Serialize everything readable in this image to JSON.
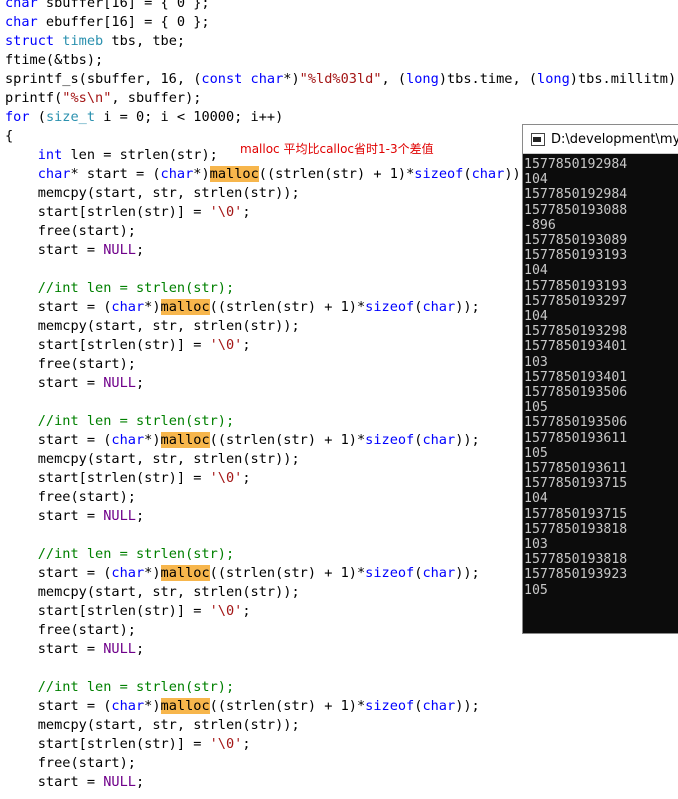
{
  "editor": {
    "code_lines": [
      [
        {
          "t": "char",
          "c": "kw"
        },
        {
          "t": " sbuffer[16] = { 0 };"
        }
      ],
      [
        {
          "t": "char",
          "c": "kw"
        },
        {
          "t": " ebuffer[16] = { 0 };"
        }
      ],
      [
        {
          "t": "struct",
          "c": "kw"
        },
        {
          "t": " "
        },
        {
          "t": "timeb",
          "c": "ty"
        },
        {
          "t": " tbs, tbe;"
        }
      ],
      [
        {
          "t": "ftime(&tbs);"
        }
      ],
      [
        {
          "t": "sprintf_s(sbuffer, 16, ("
        },
        {
          "t": "const",
          "c": "kw"
        },
        {
          "t": " "
        },
        {
          "t": "char",
          "c": "kw"
        },
        {
          "t": "*)"
        },
        {
          "t": "\"%ld%03ld\"",
          "c": "str"
        },
        {
          "t": ", ("
        },
        {
          "t": "long",
          "c": "kw"
        },
        {
          "t": ")tbs.time, ("
        },
        {
          "t": "long",
          "c": "kw"
        },
        {
          "t": ")tbs.millitm);"
        }
      ],
      [
        {
          "t": "printf("
        },
        {
          "t": "\"%s\\n\"",
          "c": "str"
        },
        {
          "t": ", sbuffer);"
        }
      ],
      [
        {
          "t": "for",
          "c": "kw"
        },
        {
          "t": " ("
        },
        {
          "t": "size_t",
          "c": "ty"
        },
        {
          "t": " i = 0; i < 10000; i++)"
        }
      ],
      [
        {
          "t": "{"
        }
      ],
      [
        {
          "t": "    "
        },
        {
          "t": "int",
          "c": "kw"
        },
        {
          "t": " len = strlen(str);"
        }
      ],
      [
        {
          "t": "    "
        },
        {
          "t": "char",
          "c": "kw"
        },
        {
          "t": "* start = ("
        },
        {
          "t": "char",
          "c": "kw"
        },
        {
          "t": "*)"
        },
        {
          "t": "malloc",
          "c": "hl"
        },
        {
          "t": "((strlen(str) + 1)*"
        },
        {
          "t": "sizeof",
          "c": "kw"
        },
        {
          "t": "("
        },
        {
          "t": "char",
          "c": "kw"
        },
        {
          "t": "));"
        }
      ],
      [
        {
          "t": "    memcpy(start, str, strlen(str));"
        }
      ],
      [
        {
          "t": "    start[strlen(str)] = "
        },
        {
          "t": "'\\0'",
          "c": "str"
        },
        {
          "t": ";"
        }
      ],
      [
        {
          "t": "    free(start);"
        }
      ],
      [
        {
          "t": "    start = "
        },
        {
          "t": "NULL",
          "c": "mac"
        },
        {
          "t": ";"
        }
      ],
      [],
      [
        {
          "t": "    "
        },
        {
          "t": "//int len = strlen(str);",
          "c": "cm"
        }
      ],
      [
        {
          "t": "    start = ("
        },
        {
          "t": "char",
          "c": "kw"
        },
        {
          "t": "*)"
        },
        {
          "t": "malloc",
          "c": "hl"
        },
        {
          "t": "((strlen(str) + 1)*"
        },
        {
          "t": "sizeof",
          "c": "kw"
        },
        {
          "t": "("
        },
        {
          "t": "char",
          "c": "kw"
        },
        {
          "t": "));"
        }
      ],
      [
        {
          "t": "    memcpy(start, str, strlen(str));"
        }
      ],
      [
        {
          "t": "    start[strlen(str)] = "
        },
        {
          "t": "'\\0'",
          "c": "str"
        },
        {
          "t": ";"
        }
      ],
      [
        {
          "t": "    free(start);"
        }
      ],
      [
        {
          "t": "    start = "
        },
        {
          "t": "NULL",
          "c": "mac"
        },
        {
          "t": ";"
        }
      ],
      [],
      [
        {
          "t": "    "
        },
        {
          "t": "//int len = strlen(str);",
          "c": "cm"
        }
      ],
      [
        {
          "t": "    start = ("
        },
        {
          "t": "char",
          "c": "kw"
        },
        {
          "t": "*)"
        },
        {
          "t": "malloc",
          "c": "hl"
        },
        {
          "t": "((strlen(str) + 1)*"
        },
        {
          "t": "sizeof",
          "c": "kw"
        },
        {
          "t": "("
        },
        {
          "t": "char",
          "c": "kw"
        },
        {
          "t": "));"
        }
      ],
      [
        {
          "t": "    memcpy(start, str, strlen(str));"
        }
      ],
      [
        {
          "t": "    start[strlen(str)] = "
        },
        {
          "t": "'\\0'",
          "c": "str"
        },
        {
          "t": ";"
        }
      ],
      [
        {
          "t": "    free(start);"
        }
      ],
      [
        {
          "t": "    start = "
        },
        {
          "t": "NULL",
          "c": "mac"
        },
        {
          "t": ";"
        }
      ],
      [],
      [
        {
          "t": "    "
        },
        {
          "t": "//int len = strlen(str);",
          "c": "cm"
        }
      ],
      [
        {
          "t": "    start = ("
        },
        {
          "t": "char",
          "c": "kw"
        },
        {
          "t": "*)"
        },
        {
          "t": "malloc",
          "c": "hl"
        },
        {
          "t": "((strlen(str) + 1)*"
        },
        {
          "t": "sizeof",
          "c": "kw"
        },
        {
          "t": "("
        },
        {
          "t": "char",
          "c": "kw"
        },
        {
          "t": "));"
        }
      ],
      [
        {
          "t": "    memcpy(start, str, strlen(str));"
        }
      ],
      [
        {
          "t": "    start[strlen(str)] = "
        },
        {
          "t": "'\\0'",
          "c": "str"
        },
        {
          "t": ";"
        }
      ],
      [
        {
          "t": "    free(start);"
        }
      ],
      [
        {
          "t": "    start = "
        },
        {
          "t": "NULL",
          "c": "mac"
        },
        {
          "t": ";"
        }
      ],
      [],
      [
        {
          "t": "    "
        },
        {
          "t": "//int len = strlen(str);",
          "c": "cm"
        }
      ],
      [
        {
          "t": "    start = ("
        },
        {
          "t": "char",
          "c": "kw"
        },
        {
          "t": "*)"
        },
        {
          "t": "malloc",
          "c": "hl"
        },
        {
          "t": "((strlen(str) + 1)*"
        },
        {
          "t": "sizeof",
          "c": "kw"
        },
        {
          "t": "("
        },
        {
          "t": "char",
          "c": "kw"
        },
        {
          "t": "));"
        }
      ],
      [
        {
          "t": "    memcpy(start, str, strlen(str));"
        }
      ],
      [
        {
          "t": "    start[strlen(str)] = "
        },
        {
          "t": "'\\0'",
          "c": "str"
        },
        {
          "t": ";"
        }
      ],
      [
        {
          "t": "    free(start);"
        }
      ],
      [
        {
          "t": "    start = "
        },
        {
          "t": "NULL",
          "c": "mac"
        },
        {
          "t": ";"
        }
      ]
    ]
  },
  "annotation": {
    "text": "malloc 平均比calloc省时1-3个差值"
  },
  "console": {
    "title": "D:\\development\\my\\c",
    "lines": [
      "1577850192984",
      "104",
      "1577850192984",
      "1577850193088",
      "-896",
      "1577850193089",
      "1577850193193",
      "104",
      "1577850193193",
      "1577850193297",
      "104",
      "1577850193298",
      "1577850193401",
      "103",
      "1577850193401",
      "1577850193506",
      "105",
      "1577850193506",
      "1577850193611",
      "105",
      "1577850193611",
      "1577850193715",
      "104",
      "1577850193715",
      "1577850193818",
      "103",
      "1577850193818",
      "1577850193923",
      "105"
    ]
  },
  "colors": {
    "keyword": "#0000ff",
    "type": "#2b91af",
    "string": "#a31515",
    "macro": "#6f008a",
    "comment": "#008000",
    "highlight": "#f7b64c",
    "annotation": "#e00000",
    "console_bg": "#0c0c0c",
    "console_text": "#c8c8c8"
  }
}
